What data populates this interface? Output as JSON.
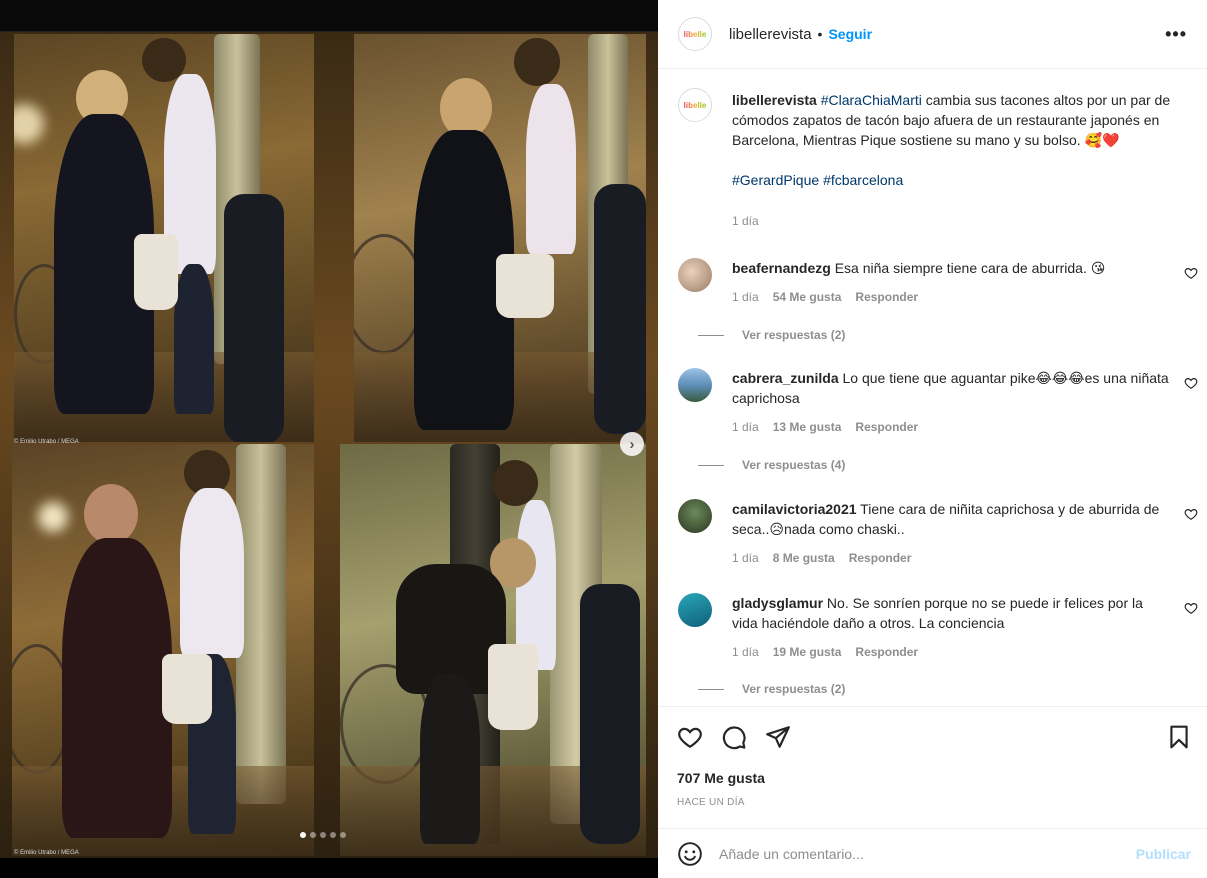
{
  "post": {
    "username": "libellerevista",
    "follow_label": "Seguir",
    "separator": "•",
    "avatar_text": "libelle"
  },
  "media": {
    "carousel_total": 5,
    "carousel_active": 1,
    "photo_credit": "© Emilio Utrabo / MEGA"
  },
  "caption": {
    "username": "libellerevista",
    "hashtag1": "#ClaraChiaMarti",
    "text": "cambia sus tacones altos por un par de cómodos zapatos de tacón bajo afuera de un restaurante japonés en Barcelona, Mientras Pique sostiene su mano y su bolso.",
    "emojis": "🥰❤️",
    "tags": [
      "#GerardPique",
      "#fcbarcelona"
    ],
    "time": "1 día"
  },
  "comments": [
    {
      "username": "beafernandezg",
      "text": "Esa niña siempre tiene cara de aburrida.",
      "emoji": "😘",
      "time": "1 día",
      "likes": "54 Me gusta",
      "reply": "Responder",
      "view_replies": "Ver respuestas (2)"
    },
    {
      "username": "cabrera_zunilda",
      "text": "Lo que tiene que aguantar pike",
      "emoji": "😂😂😂",
      "text2": "es una niñata caprichosa",
      "time": "1 día",
      "likes": "13 Me gusta",
      "reply": "Responder",
      "view_replies": "Ver respuestas (4)"
    },
    {
      "username": "camilavictoria2021",
      "text": "Tiene cara de niñita caprichosa y de aburrida de seca..",
      "emoji": "😥",
      "text2": "nada como chaski..",
      "time": "1 día",
      "likes": "8 Me gusta",
      "reply": "Responder"
    },
    {
      "username": "gladysglamur",
      "text": "No. Se sonríen porque no se puede ir felices por la vida haciéndole daño a otros. La conciencia",
      "time": "1 día",
      "likes": "19 Me gusta",
      "reply": "Responder",
      "view_replies": "Ver respuestas (2)"
    }
  ],
  "stats": {
    "likes": "707 Me gusta",
    "time": "HACE UN DÍA"
  },
  "composer": {
    "placeholder": "Añade un comentario...",
    "publish_label": "Publicar"
  },
  "icons": {
    "like": "heart-icon",
    "comment": "comment-icon",
    "share": "share-icon",
    "save": "bookmark-icon",
    "emoji": "emoji-icon",
    "next": "chevron-right-icon",
    "more": "more-options-icon"
  },
  "colors": {
    "follow": "#0095f6",
    "hashtag": "#00376b",
    "muted": "#8e8e8e",
    "publish_disabled": "#b2dffc"
  }
}
